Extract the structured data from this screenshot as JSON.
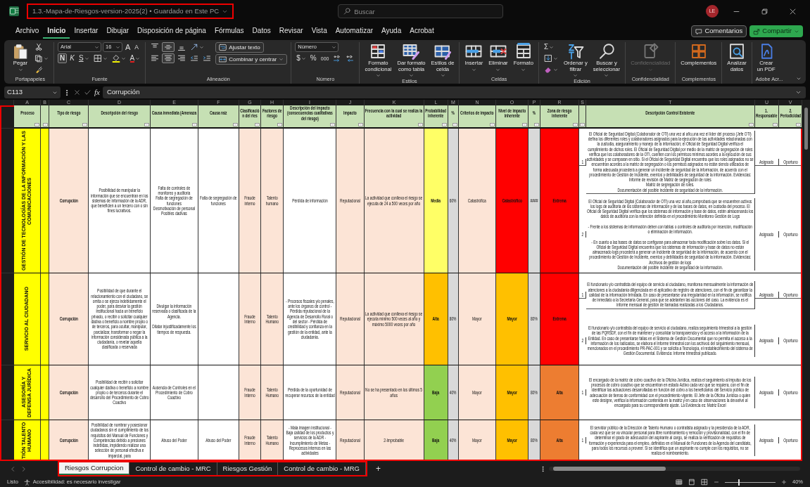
{
  "title_bar": {
    "title": "1.3.-Mapa-de-Riesgos-version-2025(2) • Guardado en Este PC",
    "search_placeholder": "Buscar",
    "avatar": "LE"
  },
  "menu": {
    "tabs": [
      {
        "label": "Archivo",
        "selected": false
      },
      {
        "label": "Inicio",
        "selected": true
      },
      {
        "label": "Insertar",
        "selected": false
      },
      {
        "label": "Dibujar",
        "selected": false
      },
      {
        "label": "Disposición de página",
        "selected": false
      },
      {
        "label": "Fórmulas",
        "selected": false
      },
      {
        "label": "Datos",
        "selected": false
      },
      {
        "label": "Revisar",
        "selected": false
      },
      {
        "label": "Vista",
        "selected": false
      },
      {
        "label": "Automatizar",
        "selected": false
      },
      {
        "label": "Ayuda",
        "selected": false
      },
      {
        "label": "Acrobat",
        "selected": false
      }
    ],
    "comments": "Comentarios",
    "share": "Compartir"
  },
  "ribbon": {
    "paste": "Pegar",
    "font": {
      "name": "Arial",
      "size": "16",
      "grow": "A",
      "shrink": "A",
      "bold": {
        "text": "N",
        "on": true
      },
      "italic": {
        "text": "K",
        "on": false
      },
      "underline": {
        "text": "S",
        "on": false
      },
      "font_color_button": "A"
    },
    "alignment": {
      "vertical": [
        {
          "on": false
        },
        {
          "on": true
        },
        {
          "on": false
        }
      ],
      "horizontal": [
        {
          "on": false
        },
        {
          "on": true
        },
        {
          "on": false
        }
      ],
      "wrap": "Ajustar texto",
      "merge": "Combinar y centrar"
    },
    "number": {
      "format": "Número",
      "currency": "$",
      "percent": "%",
      "thousands": "000"
    },
    "styles": [
      "Formato\ncondicional",
      "Dar formato\ncomo tabla",
      "Estilos de\ncelda"
    ],
    "cells": [
      "Insertar",
      "Eliminar",
      "Formato"
    ],
    "editing": {
      "sum": "Σ",
      "sort": "Ordenar y\nfiltrar",
      "find": "Buscar y\nseleccionar"
    },
    "sensitivity": {
      "label": "Confidencialidad",
      "disabled": true
    },
    "addins": "Complementos",
    "analyze": "Analizar\ndatos",
    "pdf": "Crear\nun PDF",
    "group_labels": [
      "Portapapeles",
      "Fuente",
      "Alineación",
      "Número",
      "Estilos",
      "Celdas",
      "Edición",
      "Confidencialidad",
      "Complementos",
      "Adobe Acr..."
    ]
  },
  "formula_bar": {
    "cell": "C113",
    "fx": "fx",
    "value": "Corrupción"
  },
  "sheet": {
    "columns": [
      {
        "letter": "A",
        "header": "Proceso"
      },
      {
        "letter": "B"
      },
      {
        "letter": "C",
        "header": "Tipo de riesgo"
      },
      {
        "letter": "D",
        "header": "Descripción del riesgo"
      },
      {
        "letter": "E",
        "header": "Causa inmediata (Amenaza"
      },
      {
        "letter": "F",
        "header": "Causa raíz"
      },
      {
        "letter": "G",
        "header": "Clasificación del ries"
      },
      {
        "letter": "H",
        "header": "Factores de riesgo"
      },
      {
        "letter": "I",
        "header": "Descripción del impacto (consecuencias cualitativas del riesgo)"
      },
      {
        "letter": "J",
        "header": "Impacto"
      },
      {
        "letter": "K",
        "header": "Frecuencia con la cual se realiza la actividad"
      },
      {
        "letter": "L",
        "header": "Probabilidad inherente"
      },
      {
        "letter": "M",
        "header": "%"
      },
      {
        "letter": "N",
        "header": "Criterios de impacto"
      },
      {
        "letter": "O",
        "header": "Nivel de impacto inherente"
      },
      {
        "letter": "P",
        "header": "%"
      },
      {
        "letter": "R",
        "header": "Zona de riesgo inherente"
      },
      {
        "letter": "S"
      },
      {
        "letter": "T",
        "header": "Descripción Control Existente"
      },
      {
        "letter": "U",
        "header": "1. Responsable"
      },
      {
        "letter": "V",
        "header": "2. Periodicidad"
      }
    ],
    "rows": [
      {
        "proceso": "GESTIÓN DE TECNOLOGÍAS DE LA INFORMACIÓN Y LAS COMUNICACIONES",
        "tipo": "Corrupción",
        "descripcion": "Posibilidad de manipular la información que se encuentran en los sistemas de información de la ADR, que beneficien a un tercero con o sin fines lucrativos.",
        "causa_inmediata": "Falta de controles de monitoreo y auditoria\nFalta de segregación de funciones\nDesmotivación de personal\nPosibles dadivas",
        "causa_raiz": "Falta de segregación de funciones",
        "clasificacion": "Fraude interno",
        "factores": "Talento humano",
        "descripcion_impacto": "Pérdida de información",
        "impacto": "Reputacional",
        "frecuencia": "La actividad que conlleva el riesgo se ejecuta de 24 a 500 veces por año",
        "probabilidad": {
          "text": "Media",
          "color": "#ffff66"
        },
        "probabilidad_pct": "60%",
        "criterios": "Catastrófica",
        "nivel_impacto": {
          "text": "Catastrófico",
          "color": "#ff0000"
        },
        "impacto_pct": "####",
        "zona": {
          "text": "Extrema",
          "color": "#ff0000"
        },
        "controles": [
          {
            "number": "1",
            "description": "El Oficial de Seguridad Digital (Colaborador de OTI) una vez al año,una vez el líder del proceso (Jefe OTI) defina los diferentes roles y colaboradores asignados para la ejecución de las actividades relacionadas con la custodia, aseguramiento y manejo de la información; el Oficial de Seguridad Digital verifica el cumplimiento de dichos roles. El Oficial de Seguridad Digital por medio de la matriz de segregación de roles verifica que los colaboradores de la OTI, cuenten con los permisos mínimos acordes a la ejecución de sus actividades y se comparan en sitio. Si el Oficial de Seguridad Digital encuentra que los roles asignados no se encuentran acordes a la matriz de segregación o los permisos asignados no están siendo utilizados de forma adecuada procederá a generar un incidente de seguridad de la información, de acuerdo con el procedimiento de Gestión de Incidente, eventos y debilidades de seguridad de la información. Evidencias: Informe de revisión de Matriz de segregación de roles\nMatriz de segregación de roles.\nDocumentación del posible incidente de seguridad de la información.",
            "responsable": "Asignado",
            "periodicidad": "Oportuno"
          },
          {
            "number": "2",
            "description": "El Oficial de Seguridad Digital (Colaborador de OTI) una vez al año,comprobará que se encuentren activos los logs de auditoria de los sistemas de información y de las bases de datos, en custodia del proceso. El Oficial de Seguridad Digital verifica que los sistemas de información y base de datos, estén almacenando los datos de auditoria con la retención definida en el procedimiento Monitoreo Gestión de Logs\n\n- Frente a los sistemas de información deben con tablas o controles de auditoria por inserción, modificación o eliminación de información.\n\n- En cuanto a las bases de datos se configuran para almacenar toda modificación sobre los datos. Si el Oficial de Seguridad Digital encuentra que los sistemas de información y base de datos no están almacenado logs procederá a generar un incidente de seguridad de la información, de acuerdo con el procedimiento de Gestión de Incidente, eventos y debilidades de seguridad de la información. Evidencias: Archivos de gestión de logs\nDocumentación del posible incidente de seguridad de la información.",
            "responsable": "Asignado",
            "periodicidad": "Oportuno"
          }
        ]
      },
      {
        "proceso": "SERVICIO AL CIUDADANO",
        "tipo": "Corrupción",
        "descripcion": "Posibilidad de que durante el relacionamiento con el ciudadano, se omita o se ejerza indebidamente el poder, para desviar la gestión institucional hacia un beneficio privado, o recibir o solicitar cualquier dádiva o beneficio a nombre propio o de terceros, para ocultar, manipular, parcializar, transformar o negar la información considerada pública a la ciudadanía, o revelar aquella clasificada o reservada",
        "causa_inmediata": "Divulgar la información reservada o clasificada de la Agencia.\n\nDilatar injustificadamente los tiempos de respuesta.",
        "clasificacion": "Fraude Interno",
        "factores": "Talento Humano",
        "descripcion_impacto": "- Procesos fiscales y/o penales, ante los órganos de control - Pérdida reputacional de la Agencia de Desarrollo Rural o del sector - Pérdida de credibilidad y confianza en la gestión de la entidad, ante la ciudadanía.",
        "impacto": "Reputacional",
        "frecuencia": "La actividad que conlleva el riesgo se ejecuta mínimo 500 veces al año y máximo 5000 veces por año",
        "probabilidad": {
          "text": "Alta",
          "color": "#ffc000"
        },
        "probabilidad_pct": "80%",
        "criterios": "Mayor",
        "nivel_impacto": {
          "text": "Mayor",
          "color": "#ffc000"
        },
        "impacto_pct": "80%",
        "zona": {
          "text": "Extrema",
          "color": "#ff0000"
        },
        "controles": [
          {
            "number": "1",
            "description": "El funcionario y/o contratista del equipo de servicio al ciudadano, monitorea mensualmente la información de atenciones a la ciudadanía diligenciada en el aplicativo de registro de atenciones, con el fin de garantizar la calidad de la información brindada. En caso de presentarse una irregularidad en la información, se notifica de inmediato a la Secretaría General, para que se adelanten las acciones del caso. La evidencia es el informe mensual de gestión de llamadas realizadas a los Ciudadanos.",
            "responsable": "Asignado",
            "periodicidad": "Oportuno"
          },
          {
            "number": "2",
            "description": "El funcionario y/o contratista del equipo de servicio al ciudadano, realiza seguimiento trimestral a la gestión de las PQRSDF, con el fin de mantener y consolidar la transparencia y el acceso a la información de la Entidad. En caso de presentarse fallas en el Sistema de Gestión Documental que no permita el acceso a la información de los radicados, se elabora el informe trimestral con los archivos del seguimiento mensual, mencionados en el procedimiento PR-PAC-001 y se solicita a Tecnología, el restablecimiento del sistema de Gestión Documental. Evidencia: Informe trimestral publicado.",
            "responsable": "Asignado",
            "periodicidad": "Oportuno"
          }
        ]
      },
      {
        "proceso": "ASESORÍA Y DEFENSA JURÍDICA",
        "tipo": "Corrupción",
        "descripcion": "Posibilidad de recibir o solicitar cualquier dádiva o beneficio a nombre propio o de terceros durante el desarrollo del Procedimiento de Cobro Coactivo",
        "causa_inmediata": "Ausencia de Controles en el Procedimiento de Cobro Coactivo",
        "clasificacion": "Fraude Interno",
        "factores": "Talento Humano",
        "descripcion_impacto": "Pérdida de la oportunidad de recuperar recursos de la entidad",
        "impacto": "Reputacional",
        "frecuencia": "No se ha presentado en los últimos 5 años",
        "probabilidad": {
          "text": "Baja",
          "color": "#92d050"
        },
        "probabilidad_pct": "40%",
        "criterios": "Mayor",
        "nivel_impacto": {
          "text": "Mayor",
          "color": "#ffc000"
        },
        "impacto_pct": "80%",
        "zona": {
          "text": "Alta",
          "color": "#ed7d31"
        },
        "controles": [
          {
            "number": "1",
            "description": "El encargado de la matriz de cobro coactivo de la Oficina Jurídica, realiza el seguimiento al impulso de los procesos de cobro coactivo que se encuentran en estado Activo cada vez que se requiera, con el fin de identificar las actuaciones desarrolladas en función del cobro a los beneficiarios del Servicio público de adecuación de tierras de conformidad con el procedimiento vigente. El Jefe de la Oficina Jurídica o quien este designe, verifica la información contenida en la matriz y en caso de observaciones la devuelve al encargado para su correspondiente ajuste. La Evidencia es: Matriz Excel",
            "responsable": "Asignado",
            "periodicidad": "Oportuno"
          }
        ]
      },
      {
        "proceso": "TIÓN TALENTO HUMANO",
        "tipo": "Corrupción",
        "descripcion": "Posibilidad de nombrar y posesionar ciudadanos sin el cumplimiento de los requisitos del Manual de Funciones y Competencias debido a presiones indebidas, impidiendo realizar una selección de personal efectiva e imparcial, para",
        "causa_inmediata": "Abuso del Poder",
        "causa_raiz": "Abuso del Poder",
        "clasificacion": "Fraude Interno",
        "factores": "Talento Humano",
        "descripcion_impacto": "- Mala imagen institucional - Baja calidad de los productos y servicios de la ADR - Incumplimiento de Metas - Reprocesos internos en las actividades",
        "impacto": "Reputacional",
        "frecuencia": "2-Improbable",
        "probabilidad": {
          "text": "Baja",
          "color": "#92d050"
        },
        "probabilidad_pct": "40%",
        "criterios": "Mayor",
        "nivel_impacto": {
          "text": "Mayor",
          "color": "#ffc000"
        },
        "impacto_pct": "80%",
        "zona": {
          "text": "Alta",
          "color": "#ed7d31"
        },
        "controles": [
          {
            "number": "1",
            "description": "El servidor público de la Dirección de Talento Humano o contratista asignado y la presidencia de la ADR, cada vez que se va vincular personal para libre nombramiento y remoción y provisionalidad, con el fin de determinar el grado de adecuación del aspirante al cargo, se realiza la verificación de requisitos de formación y experiencia para el empleo, definidos en el Manual de Funciones de la Agencia del candidato, para todos los recursos a proveer. Si se identifica que un aspirante no cumple con los requisitos, no se realiza el nombramiento.",
            "responsable": "Asignado",
            "periodicidad": "Oportuno"
          }
        ]
      }
    ]
  },
  "sheet_tabs": [
    {
      "label": "Riesgos Corrupcion",
      "selected": true
    },
    {
      "label": "Control de cambio - MRC",
      "selected": false
    },
    {
      "label": "Riesgos Gestión",
      "selected": false
    },
    {
      "label": "Control de cambio - MRG",
      "selected": false
    }
  ],
  "add_sheet": "+",
  "status_bar": {
    "ready": "Listo",
    "accessibility": "Accesibilidad: es necesario investigar",
    "zoom_slider": {
      "level": 0.27
    },
    "zoom": "40%"
  }
}
